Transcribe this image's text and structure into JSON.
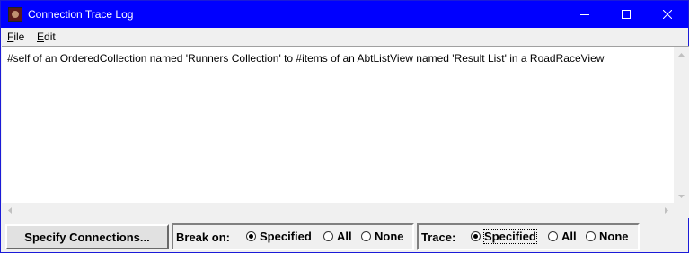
{
  "window": {
    "title": "Connection Trace Log"
  },
  "menu": {
    "file": "ile",
    "file_mnemonic": "F",
    "edit": "dit",
    "edit_mnemonic": "E"
  },
  "log": {
    "lines": [
      "#self of an OrderedCollection named 'Runners Collection' to #items of an AbtListView named 'Result List' in a RoadRaceView"
    ]
  },
  "bottom": {
    "specify_button": "Specify Connections...",
    "break_on": {
      "label": "Break on:",
      "options": [
        "Specified",
        "All",
        "None"
      ],
      "selected": "Specified"
    },
    "trace": {
      "label": "Trace:",
      "options": [
        "Specified",
        "All",
        "None"
      ],
      "selected": "Specified"
    }
  },
  "colors": {
    "titlebar": "#0000ff",
    "background": "#f0f0f0"
  }
}
